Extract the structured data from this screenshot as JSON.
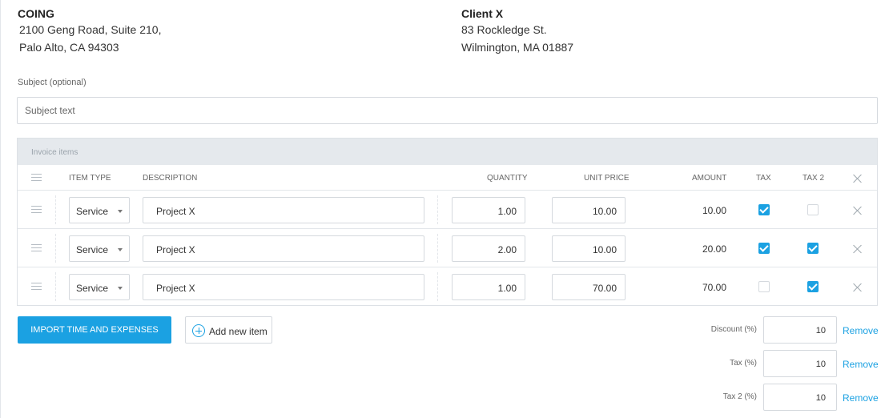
{
  "from": {
    "name": "COING",
    "address_line1": "2100 Geng Road, Suite 210,",
    "address_line2": "Palo Alto, CA 94303"
  },
  "to": {
    "name": "Client X",
    "address_line1": "83 Rockledge St.",
    "address_line2": "Wilmington, MA 01887"
  },
  "subject": {
    "label": "Subject (optional)",
    "placeholder": "Subject text",
    "value": ""
  },
  "items": {
    "panel_title": "Invoice items",
    "columns": {
      "item_type": "ITEM TYPE",
      "description": "DESCRIPTION",
      "quantity": "QUANTITY",
      "unit_price": "UNIT PRICE",
      "amount": "AMOUNT",
      "tax": "TAX",
      "tax2": "TAX 2"
    },
    "rows": [
      {
        "type": "Service",
        "description": "Project X",
        "quantity": "1.00",
        "unit_price": "10.00",
        "amount": "10.00",
        "tax": true,
        "tax2": false
      },
      {
        "type": "Service",
        "description": "Project X",
        "quantity": "2.00",
        "unit_price": "10.00",
        "amount": "20.00",
        "tax": true,
        "tax2": true
      },
      {
        "type": "Service",
        "description": "Project X",
        "quantity": "1.00",
        "unit_price": "70.00",
        "amount": "70.00",
        "tax": false,
        "tax2": true
      }
    ]
  },
  "actions": {
    "import_label": "IMPORT TIME AND EXPENSES",
    "add_label": "Add new item"
  },
  "adjustments": {
    "discount": {
      "label": "Discount (%)",
      "value": "10",
      "remove": "Remove"
    },
    "tax": {
      "label": "Tax (%)",
      "value": "10",
      "remove": "Remove"
    },
    "tax2": {
      "label": "Tax 2 (%)",
      "value": "10",
      "remove": "Remove"
    }
  },
  "colors": {
    "accent": "#1ba1e2",
    "header_bg": "#e5e9ed",
    "border": "#d5d9de"
  },
  "icons": {
    "row_handle": "drag-handle-icon",
    "delete": "close-icon",
    "add": "plus-circle-icon",
    "dropdown": "chevron-down-icon",
    "checked": "checkbox-checked-icon"
  }
}
